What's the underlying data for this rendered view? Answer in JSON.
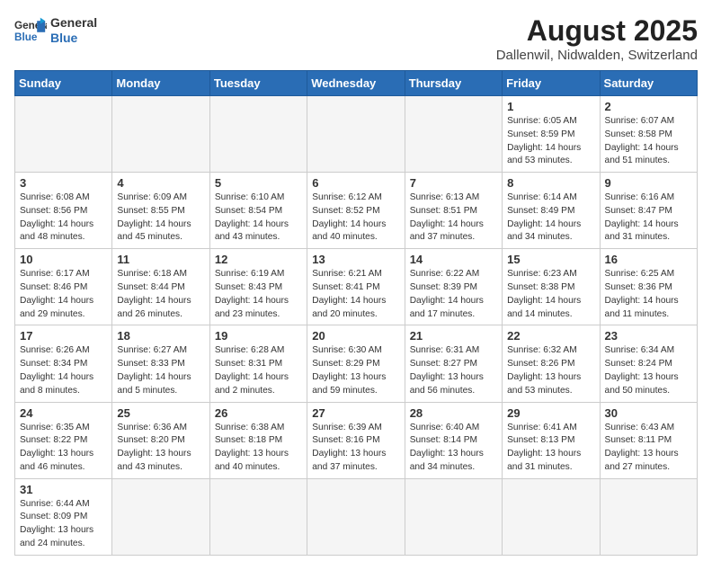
{
  "header": {
    "logo_general": "General",
    "logo_blue": "Blue",
    "month": "August 2025",
    "location": "Dallenwil, Nidwalden, Switzerland"
  },
  "weekdays": [
    "Sunday",
    "Monday",
    "Tuesday",
    "Wednesday",
    "Thursday",
    "Friday",
    "Saturday"
  ],
  "weeks": [
    [
      {
        "day": "",
        "info": ""
      },
      {
        "day": "",
        "info": ""
      },
      {
        "day": "",
        "info": ""
      },
      {
        "day": "",
        "info": ""
      },
      {
        "day": "",
        "info": ""
      },
      {
        "day": "1",
        "info": "Sunrise: 6:05 AM\nSunset: 8:59 PM\nDaylight: 14 hours and 53 minutes."
      },
      {
        "day": "2",
        "info": "Sunrise: 6:07 AM\nSunset: 8:58 PM\nDaylight: 14 hours and 51 minutes."
      }
    ],
    [
      {
        "day": "3",
        "info": "Sunrise: 6:08 AM\nSunset: 8:56 PM\nDaylight: 14 hours and 48 minutes."
      },
      {
        "day": "4",
        "info": "Sunrise: 6:09 AM\nSunset: 8:55 PM\nDaylight: 14 hours and 45 minutes."
      },
      {
        "day": "5",
        "info": "Sunrise: 6:10 AM\nSunset: 8:54 PM\nDaylight: 14 hours and 43 minutes."
      },
      {
        "day": "6",
        "info": "Sunrise: 6:12 AM\nSunset: 8:52 PM\nDaylight: 14 hours and 40 minutes."
      },
      {
        "day": "7",
        "info": "Sunrise: 6:13 AM\nSunset: 8:51 PM\nDaylight: 14 hours and 37 minutes."
      },
      {
        "day": "8",
        "info": "Sunrise: 6:14 AM\nSunset: 8:49 PM\nDaylight: 14 hours and 34 minutes."
      },
      {
        "day": "9",
        "info": "Sunrise: 6:16 AM\nSunset: 8:47 PM\nDaylight: 14 hours and 31 minutes."
      }
    ],
    [
      {
        "day": "10",
        "info": "Sunrise: 6:17 AM\nSunset: 8:46 PM\nDaylight: 14 hours and 29 minutes."
      },
      {
        "day": "11",
        "info": "Sunrise: 6:18 AM\nSunset: 8:44 PM\nDaylight: 14 hours and 26 minutes."
      },
      {
        "day": "12",
        "info": "Sunrise: 6:19 AM\nSunset: 8:43 PM\nDaylight: 14 hours and 23 minutes."
      },
      {
        "day": "13",
        "info": "Sunrise: 6:21 AM\nSunset: 8:41 PM\nDaylight: 14 hours and 20 minutes."
      },
      {
        "day": "14",
        "info": "Sunrise: 6:22 AM\nSunset: 8:39 PM\nDaylight: 14 hours and 17 minutes."
      },
      {
        "day": "15",
        "info": "Sunrise: 6:23 AM\nSunset: 8:38 PM\nDaylight: 14 hours and 14 minutes."
      },
      {
        "day": "16",
        "info": "Sunrise: 6:25 AM\nSunset: 8:36 PM\nDaylight: 14 hours and 11 minutes."
      }
    ],
    [
      {
        "day": "17",
        "info": "Sunrise: 6:26 AM\nSunset: 8:34 PM\nDaylight: 14 hours and 8 minutes."
      },
      {
        "day": "18",
        "info": "Sunrise: 6:27 AM\nSunset: 8:33 PM\nDaylight: 14 hours and 5 minutes."
      },
      {
        "day": "19",
        "info": "Sunrise: 6:28 AM\nSunset: 8:31 PM\nDaylight: 14 hours and 2 minutes."
      },
      {
        "day": "20",
        "info": "Sunrise: 6:30 AM\nSunset: 8:29 PM\nDaylight: 13 hours and 59 minutes."
      },
      {
        "day": "21",
        "info": "Sunrise: 6:31 AM\nSunset: 8:27 PM\nDaylight: 13 hours and 56 minutes."
      },
      {
        "day": "22",
        "info": "Sunrise: 6:32 AM\nSunset: 8:26 PM\nDaylight: 13 hours and 53 minutes."
      },
      {
        "day": "23",
        "info": "Sunrise: 6:34 AM\nSunset: 8:24 PM\nDaylight: 13 hours and 50 minutes."
      }
    ],
    [
      {
        "day": "24",
        "info": "Sunrise: 6:35 AM\nSunset: 8:22 PM\nDaylight: 13 hours and 46 minutes."
      },
      {
        "day": "25",
        "info": "Sunrise: 6:36 AM\nSunset: 8:20 PM\nDaylight: 13 hours and 43 minutes."
      },
      {
        "day": "26",
        "info": "Sunrise: 6:38 AM\nSunset: 8:18 PM\nDaylight: 13 hours and 40 minutes."
      },
      {
        "day": "27",
        "info": "Sunrise: 6:39 AM\nSunset: 8:16 PM\nDaylight: 13 hours and 37 minutes."
      },
      {
        "day": "28",
        "info": "Sunrise: 6:40 AM\nSunset: 8:14 PM\nDaylight: 13 hours and 34 minutes."
      },
      {
        "day": "29",
        "info": "Sunrise: 6:41 AM\nSunset: 8:13 PM\nDaylight: 13 hours and 31 minutes."
      },
      {
        "day": "30",
        "info": "Sunrise: 6:43 AM\nSunset: 8:11 PM\nDaylight: 13 hours and 27 minutes."
      }
    ],
    [
      {
        "day": "31",
        "info": "Sunrise: 6:44 AM\nSunset: 8:09 PM\nDaylight: 13 hours and 24 minutes."
      },
      {
        "day": "",
        "info": ""
      },
      {
        "day": "",
        "info": ""
      },
      {
        "day": "",
        "info": ""
      },
      {
        "day": "",
        "info": ""
      },
      {
        "day": "",
        "info": ""
      },
      {
        "day": "",
        "info": ""
      }
    ]
  ]
}
